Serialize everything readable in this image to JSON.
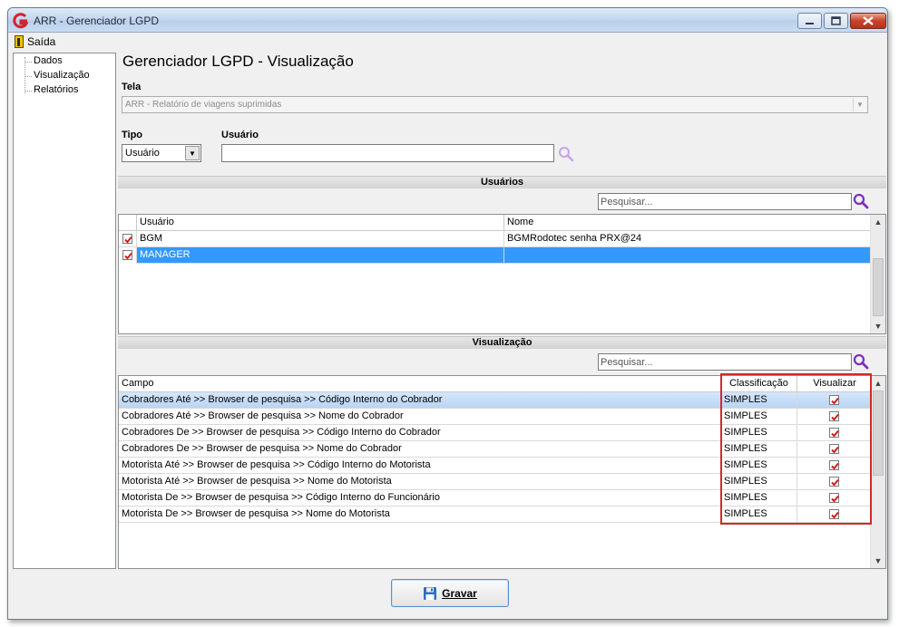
{
  "window": {
    "title": "ARR - Gerenciador LGPD"
  },
  "menu": {
    "exit_label": "Saída"
  },
  "tree": {
    "items": [
      "Dados",
      "Visualização",
      "Relatórios"
    ]
  },
  "page": {
    "heading": "Gerenciador LGPD - Visualização"
  },
  "tela": {
    "label": "Tela",
    "value": "ARR - Relatório de viagens suprimidas"
  },
  "tipo": {
    "label": "Tipo",
    "value": "Usuário"
  },
  "usuario": {
    "label": "Usuário",
    "value": ""
  },
  "users_section": {
    "title": "Usuários",
    "search_placeholder": "Pesquisar...",
    "columns": [
      "Usuário",
      "Nome"
    ],
    "rows": [
      {
        "user": "BGM",
        "name": "BGMRodotec senha PRX@24",
        "checked": true,
        "selected": false
      },
      {
        "user": "MANAGER",
        "name": "",
        "checked": true,
        "selected": true
      }
    ]
  },
  "view_section": {
    "title": "Visualização",
    "search_placeholder": "Pesquisar...",
    "columns": [
      "Campo",
      "Classificação",
      "Visualizar"
    ],
    "rows": [
      {
        "campo": "Cobradores Até >> Browser de pesquisa >> Código Interno do Cobrador",
        "classificacao": "SIMPLES",
        "visualizar": true
      },
      {
        "campo": "Cobradores Até >> Browser de pesquisa >> Nome do Cobrador",
        "classificacao": "SIMPLES",
        "visualizar": true
      },
      {
        "campo": "Cobradores De >> Browser de pesquisa >> Código Interno do Cobrador",
        "classificacao": "SIMPLES",
        "visualizar": true
      },
      {
        "campo": "Cobradores De >> Browser de pesquisa >> Nome do Cobrador",
        "classificacao": "SIMPLES",
        "visualizar": true
      },
      {
        "campo": "Motorista Até >> Browser de pesquisa >> Código Interno do Motorista",
        "classificacao": "SIMPLES",
        "visualizar": true
      },
      {
        "campo": "Motorista Até >> Browser de pesquisa >> Nome do Motorista",
        "classificacao": "SIMPLES",
        "visualizar": true
      },
      {
        "campo": "Motorista De >> Browser de pesquisa >> Código Interno do Funcionário",
        "classificacao": "SIMPLES",
        "visualizar": true
      },
      {
        "campo": "Motorista De >> Browser de pesquisa >> Nome do Motorista",
        "classificacao": "SIMPLES",
        "visualizar": true
      }
    ]
  },
  "save_button": {
    "label": "Gravar"
  },
  "colors": {
    "selection": "#3399ff",
    "highlight": "#d12a2a",
    "search_icon": "#7b2fbe",
    "check": "#cc1f1f"
  }
}
